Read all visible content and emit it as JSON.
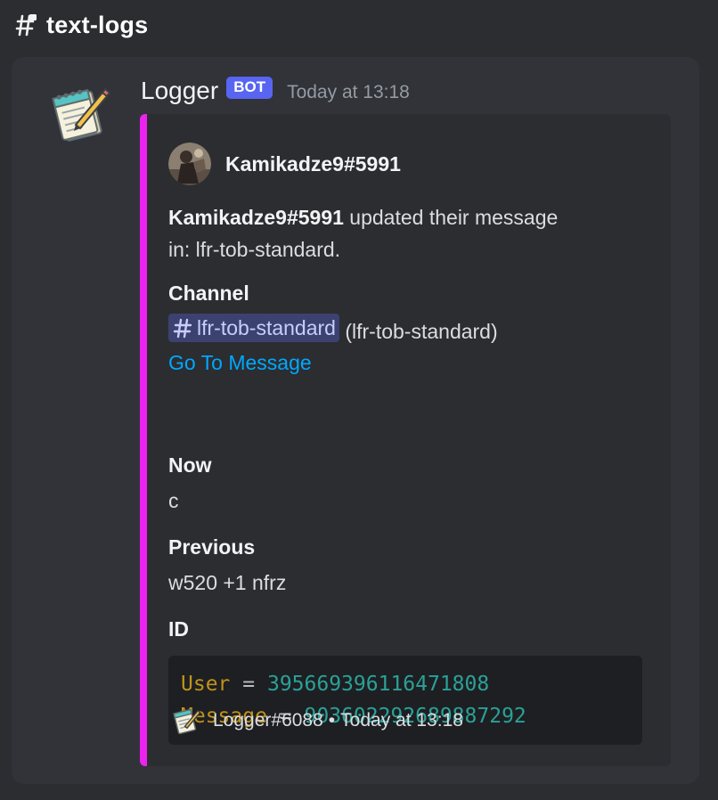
{
  "channel": {
    "name": "text-logs",
    "icon": "locked-hash-icon"
  },
  "message": {
    "author": "Logger",
    "badge": "BOT",
    "timestamp": "Today at 13:18",
    "avatar_icon": "notepad-icon"
  },
  "embed": {
    "accent_color": "#eb22f0",
    "author": {
      "name": "Kamikadze9#5991",
      "avatar": "user-avatar"
    },
    "description": {
      "user": "Kamikadze9#5991",
      "text_1": " updated their message",
      "text_2": "in: lfr-tob-standard."
    },
    "fields": {
      "channel": {
        "name": "Channel",
        "mention": "lfr-tob-standard",
        "suffix": " (lfr-tob-standard)",
        "link": "Go To Message"
      },
      "now": {
        "name": "Now",
        "value": "c"
      },
      "previous": {
        "name": "Previous",
        "value": "w520 +1 nfrz"
      },
      "id": {
        "name": "ID",
        "user_key": "User",
        "user_value": "395669396116471808",
        "message_key": "Message",
        "message_value": "903602292689887292",
        "equals": "="
      }
    },
    "footer": {
      "text": "Logger#6088",
      "separator": "•",
      "timestamp": "Today at 13:18"
    }
  }
}
